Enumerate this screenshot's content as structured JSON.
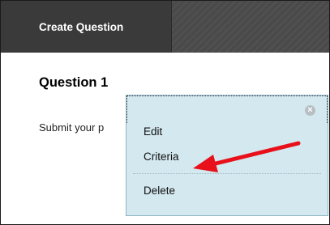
{
  "header": {
    "tab_label": "Create Question"
  },
  "question": {
    "title": "Question 1",
    "text_truncated": "Submit your p"
  },
  "context_menu": {
    "items": [
      {
        "label": "Edit"
      },
      {
        "label": "Criteria"
      },
      {
        "label": "Delete"
      }
    ],
    "close_icon": "close-circle-icon"
  },
  "colors": {
    "topbar": "#4a4a4a",
    "tab": "#3a3a3a",
    "menu_bg": "#d3e8ef",
    "arrow": "#e8101a"
  }
}
